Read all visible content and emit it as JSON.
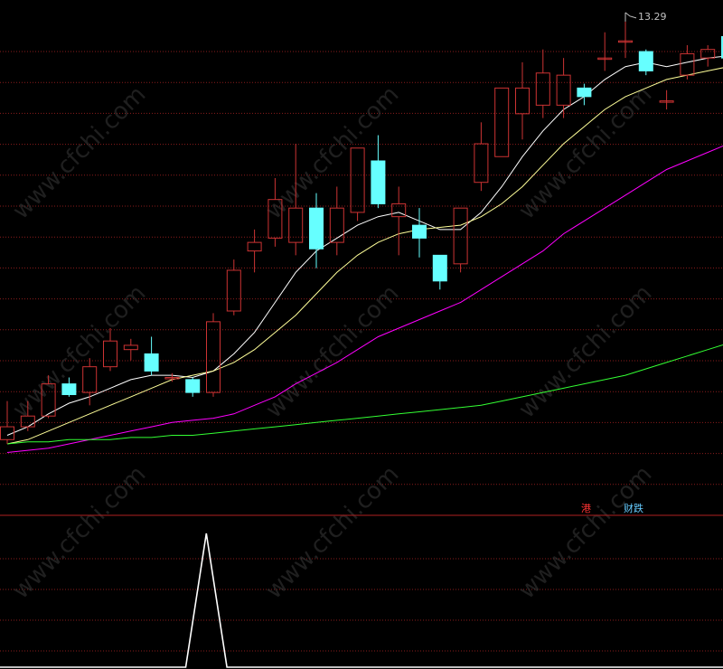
{
  "chart_data": [
    {
      "type": "candlestick",
      "panel": "price",
      "annotations": {
        "high_label": "13.29"
      },
      "candles": [
        {
          "open": 4.0,
          "close": 4.3,
          "high": 4.9,
          "low": 3.9
        },
        {
          "open": 4.3,
          "close": 4.55,
          "high": 4.9,
          "low": 4.2
        },
        {
          "open": 4.55,
          "close": 5.3,
          "high": 5.5,
          "low": 4.5
        },
        {
          "open": 5.3,
          "close": 5.05,
          "high": 5.45,
          "low": 5.0
        },
        {
          "open": 5.1,
          "close": 5.7,
          "high": 5.9,
          "low": 4.8
        },
        {
          "open": 5.7,
          "close": 6.3,
          "high": 6.6,
          "low": 5.6
        },
        {
          "open": 6.1,
          "close": 6.2,
          "high": 6.35,
          "low": 5.85
        },
        {
          "open": 6.0,
          "close": 5.6,
          "high": 6.4,
          "low": 5.5
        },
        {
          "open": 5.45,
          "close": 5.45,
          "high": 5.55,
          "low": 5.35
        },
        {
          "open": 5.4,
          "close": 5.1,
          "high": 5.45,
          "low": 5.0
        },
        {
          "open": 5.1,
          "close": 6.75,
          "high": 6.95,
          "low": 5.0
        },
        {
          "open": 7.0,
          "close": 7.95,
          "high": 8.2,
          "low": 6.9
        },
        {
          "open": 8.4,
          "close": 8.6,
          "high": 8.9,
          "low": 7.9
        },
        {
          "open": 8.7,
          "close": 9.6,
          "high": 10.1,
          "low": 8.5
        },
        {
          "open": 8.6,
          "close": 9.4,
          "high": 10.9,
          "low": 8.3
        },
        {
          "open": 9.4,
          "close": 8.45,
          "high": 9.75,
          "low": 8.0
        },
        {
          "open": 8.6,
          "close": 9.4,
          "high": 9.9,
          "low": 8.3
        },
        {
          "open": 9.3,
          "close": 10.8,
          "high": 10.8,
          "low": 9.1
        },
        {
          "open": 10.5,
          "close": 9.5,
          "high": 11.1,
          "low": 9.4
        },
        {
          "open": 9.2,
          "close": 9.5,
          "high": 9.9,
          "low": 8.3
        },
        {
          "open": 9.0,
          "close": 8.7,
          "high": 9.4,
          "low": 8.25
        },
        {
          "open": 8.3,
          "close": 7.7,
          "high": 8.3,
          "low": 7.5
        },
        {
          "open": 8.1,
          "close": 9.4,
          "high": 9.4,
          "low": 7.9
        },
        {
          "open": 10.0,
          "close": 10.9,
          "high": 11.4,
          "low": 9.8
        },
        {
          "open": 10.6,
          "close": 12.2,
          "high": 12.2,
          "low": 10.6
        },
        {
          "open": 11.6,
          "close": 12.2,
          "high": 12.8,
          "low": 11.0
        },
        {
          "open": 11.8,
          "close": 12.55,
          "high": 13.1,
          "low": 11.5
        },
        {
          "open": 11.8,
          "close": 12.5,
          "high": 12.9,
          "low": 11.5
        },
        {
          "open": 12.2,
          "close": 12.0,
          "high": 12.3,
          "low": 11.8
        },
        {
          "open": 12.9,
          "close": 12.9,
          "high": 13.5,
          "low": 12.6
        },
        {
          "open": 13.3,
          "close": 13.3,
          "high": 13.75,
          "low": 12.9
        },
        {
          "open": 13.05,
          "close": 12.6,
          "high": 13.1,
          "low": 12.5
        },
        {
          "open": 11.9,
          "close": 11.9,
          "high": 12.15,
          "low": 11.7
        },
        {
          "open": 12.5,
          "close": 13.0,
          "high": 13.2,
          "low": 12.4
        },
        {
          "open": 12.9,
          "close": 13.1,
          "high": 13.2,
          "low": 12.7
        },
        {
          "open": 13.4,
          "close": 12.9,
          "high": 13.5,
          "low": 12.8
        }
      ],
      "series": [
        {
          "color": "#ffffff",
          "values": [
            4.1,
            4.3,
            4.6,
            4.85,
            5.0,
            5.2,
            5.4,
            5.5,
            5.5,
            5.45,
            5.6,
            6.0,
            6.5,
            7.2,
            7.9,
            8.4,
            8.7,
            9.0,
            9.2,
            9.3,
            9.1,
            8.9,
            8.9,
            9.3,
            9.9,
            10.6,
            11.2,
            11.7,
            12.0,
            12.4,
            12.7,
            12.8,
            12.7,
            12.8,
            12.9,
            12.95
          ]
        },
        {
          "color": "#ffff99",
          "values": [
            3.9,
            4.0,
            4.2,
            4.4,
            4.6,
            4.8,
            5.0,
            5.2,
            5.4,
            5.5,
            5.6,
            5.8,
            6.1,
            6.5,
            6.9,
            7.4,
            7.9,
            8.3,
            8.6,
            8.8,
            8.9,
            8.95,
            9.0,
            9.2,
            9.5,
            9.9,
            10.4,
            10.9,
            11.3,
            11.7,
            12.0,
            12.2,
            12.4,
            12.5,
            12.6,
            12.7
          ]
        },
        {
          "color": "#ff00ff",
          "values": [
            3.7,
            3.75,
            3.8,
            3.9,
            4.0,
            4.1,
            4.2,
            4.3,
            4.4,
            4.45,
            4.5,
            4.6,
            4.8,
            5.0,
            5.3,
            5.55,
            5.8,
            6.1,
            6.4,
            6.6,
            6.8,
            7.0,
            7.2,
            7.5,
            7.8,
            8.1,
            8.4,
            8.8,
            9.1,
            9.4,
            9.7,
            10.0,
            10.3,
            10.5,
            10.7,
            10.9
          ]
        },
        {
          "color": "#33ff33",
          "values": [
            3.9,
            3.95,
            3.95,
            4.0,
            4.0,
            4.0,
            4.05,
            4.05,
            4.1,
            4.1,
            4.15,
            4.2,
            4.25,
            4.3,
            4.35,
            4.4,
            4.45,
            4.5,
            4.55,
            4.6,
            4.65,
            4.7,
            4.75,
            4.8,
            4.9,
            5.0,
            5.1,
            5.2,
            5.3,
            5.4,
            5.5,
            5.65,
            5.8,
            5.95,
            6.1,
            6.25
          ]
        }
      ]
    },
    {
      "type": "line",
      "panel": "indicator",
      "labels": [
        {
          "text": "港",
          "color": "#ff3333"
        },
        {
          "text": "财跌",
          "color": "#66ccff"
        }
      ],
      "series": [
        {
          "color": "#ffffff",
          "values": [
            0,
            0,
            0,
            0,
            0,
            0,
            0,
            0,
            0,
            0,
            1,
            0,
            0,
            0,
            0,
            0,
            0,
            0,
            0,
            0,
            0,
            0,
            0,
            0,
            0,
            0,
            0,
            0,
            0,
            0,
            0,
            0,
            0,
            0,
            0,
            0
          ]
        }
      ]
    }
  ],
  "watermark": "www.cfchi.com",
  "colors": {
    "background": "#000000",
    "up": "#cc3333",
    "down": "#66ffff",
    "grid": "#8a1c1c",
    "separator": "#b02020",
    "high_label": "#c0c0c0"
  }
}
